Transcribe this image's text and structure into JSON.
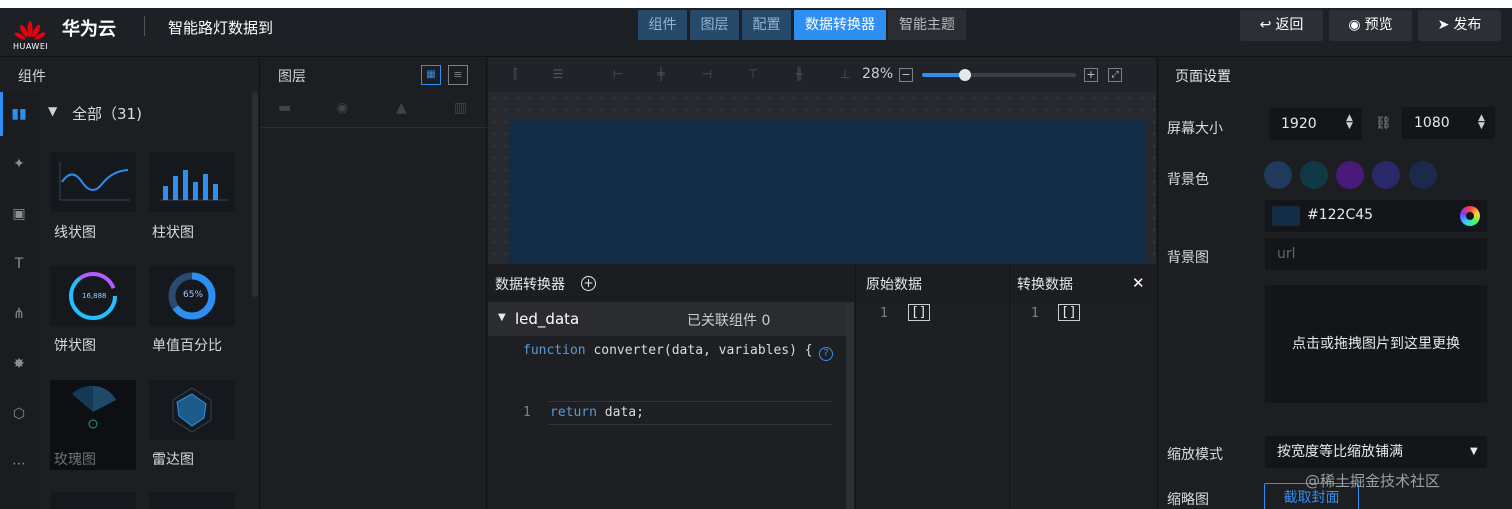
{
  "header": {
    "brand_logo_text": "HUAWEI",
    "brand_name": "华为云",
    "project_title": "智能路灯数据到",
    "tabs": [
      {
        "label": "组件",
        "active": false
      },
      {
        "label": "图层",
        "active": false
      },
      {
        "label": "配置",
        "active": false
      },
      {
        "label": "数据转换器",
        "active": true
      },
      {
        "label": "智能主题",
        "active": false
      }
    ],
    "actions": {
      "back": "返回",
      "preview": "预览",
      "publish": "发布"
    }
  },
  "components_panel": {
    "title": "组件",
    "category_label": "全部（31)",
    "items": [
      {
        "label": "线状图",
        "icon": "line-chart-thumb"
      },
      {
        "label": "柱状图",
        "icon": "bar-chart-thumb"
      },
      {
        "label": "饼状图",
        "icon": "pie-chart-thumb"
      },
      {
        "label": "单值百分比",
        "icon": "percent-gauge-thumb"
      },
      {
        "label": "玫瑰图",
        "icon": "rose-chart-thumb"
      },
      {
        "label": "雷达图",
        "icon": "radar-chart-thumb"
      }
    ],
    "pie_thumb_value": "16,888",
    "percent_thumb_value": "65%"
  },
  "layers_panel": {
    "title": "图层"
  },
  "canvas": {
    "zoom_label": "28%",
    "zoom_fraction": 0.28,
    "screen_color": "#122c45"
  },
  "converter": {
    "title": "数据转换器",
    "dataset_name": "led_data",
    "linked_label": "已关联组件 0",
    "code_signature": "function converter(data, variables) {",
    "code_line_number": "1",
    "code_body": "return data;",
    "help_icon": "?"
  },
  "raw_data": {
    "title": "原始数据",
    "line_number": "1",
    "content": "[]"
  },
  "converted_data": {
    "title": "转换数据",
    "line_number": "1",
    "content": "[]"
  },
  "page_settings": {
    "title": "页面设置",
    "screen_size_label": "屏幕大小",
    "width": "1920",
    "height": "1080",
    "bg_color_label": "背景色",
    "bg_color_value": "#122C45",
    "bg_image_label": "背景图",
    "bg_image_placeholder": "url",
    "upload_hint": "点击或拖拽图片到这里更换",
    "scale_mode_label": "缩放模式",
    "scale_mode_value": "按宽度等比缩放铺满",
    "thumbnail_label": "缩略图",
    "capture_button": "截取封面",
    "swatches": [
      "#1f3a5a",
      "#0f3a45",
      "#4a1a7a",
      "#2a2a6a",
      "#1a2a4a"
    ]
  },
  "watermark": "@稀土掘金技术社区"
}
